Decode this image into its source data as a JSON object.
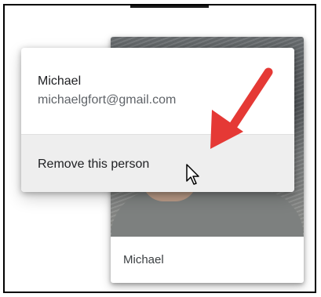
{
  "menu": {
    "name": "Michael",
    "email": "michaelgfort@gmail.com",
    "remove_label": "Remove this person"
  },
  "card": {
    "name": "Michael"
  },
  "icons": {
    "annotation": "arrow-icon",
    "pointer": "mouse-cursor-icon"
  },
  "colors": {
    "annotation_arrow": "#e53935",
    "menu_hover": "#eeeeee",
    "text_primary": "#202124",
    "text_secondary": "#5f6368"
  }
}
